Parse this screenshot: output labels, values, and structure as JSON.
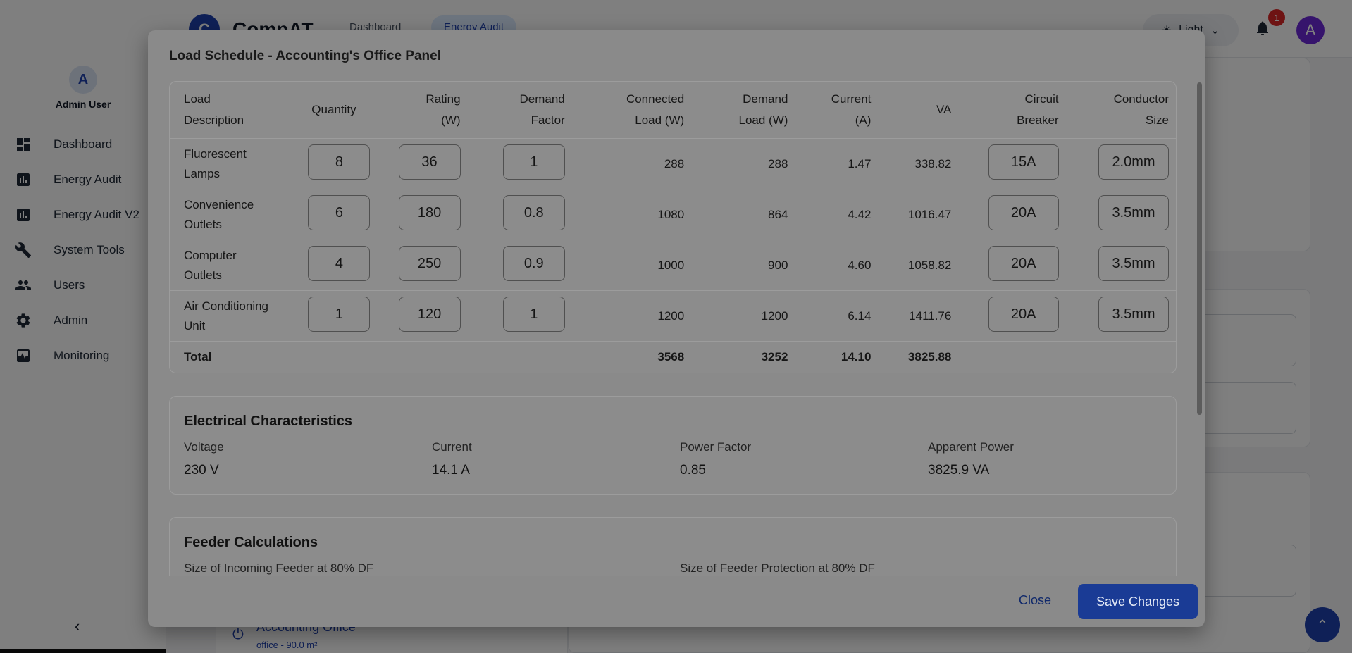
{
  "app": {
    "brand": "CompAT",
    "logo_letter": "C",
    "top_tabs": [
      "Dashboard",
      "Energy Audit"
    ],
    "theme_label": "Light",
    "notification_count": "1",
    "avatar_letter": "A"
  },
  "sidebar": {
    "avatar_letter": "A",
    "user_name": "Admin User",
    "items": [
      {
        "label": "Dashboard",
        "icon": "dashboard-icon"
      },
      {
        "label": "Energy Audit",
        "icon": "bar-chart-icon"
      },
      {
        "label": "Energy Audit V2",
        "icon": "bar-chart-icon"
      },
      {
        "label": "System Tools",
        "icon": "wrench-icon"
      },
      {
        "label": "Users",
        "icon": "users-icon"
      },
      {
        "label": "Admin",
        "icon": "gear-icon"
      },
      {
        "label": "Monitoring",
        "icon": "monitor-icon"
      }
    ],
    "collapse_glyph": "‹"
  },
  "background": {
    "office_name": "Accounting Office",
    "office_sub": "office - 90.0 m²"
  },
  "modal": {
    "title": "Load Schedule - Accounting's Office Panel",
    "headers": {
      "description": [
        "Load",
        "Description"
      ],
      "quantity": "Quantity",
      "rating": [
        "Rating",
        "(W)"
      ],
      "demand_factor": [
        "Demand",
        "Factor"
      ],
      "connected_load": [
        "Connected",
        "Load (W)"
      ],
      "demand_load": [
        "Demand",
        "Load (W)"
      ],
      "current": [
        "Current",
        "(A)"
      ],
      "va": "VA",
      "breaker": [
        "Circuit",
        "Breaker"
      ],
      "conductor": [
        "Conductor",
        "Size"
      ]
    },
    "rows": [
      {
        "desc1": "Fluorescent",
        "desc2": "Lamps",
        "quantity": "8",
        "rating": "36",
        "demand_factor": "1",
        "connected": "288",
        "demand": "288",
        "current": "1.47",
        "va": "338.82",
        "breaker": "15A",
        "conductor": "2.0mm"
      },
      {
        "desc1": "Convenience",
        "desc2": "Outlets",
        "quantity": "6",
        "rating": "180",
        "demand_factor": "0.8",
        "connected": "1080",
        "demand": "864",
        "current": "4.42",
        "va": "1016.47",
        "breaker": "20A",
        "conductor": "3.5mm"
      },
      {
        "desc1": "Computer",
        "desc2": "Outlets",
        "quantity": "4",
        "rating": "250",
        "demand_factor": "0.9",
        "connected": "1000",
        "demand": "900",
        "current": "4.60",
        "va": "1058.82",
        "breaker": "20A",
        "conductor": "3.5mm"
      },
      {
        "desc1": "Air Conditioning",
        "desc2": "Unit",
        "quantity": "1",
        "rating": "120",
        "demand_factor": "1",
        "connected": "1200",
        "demand": "1200",
        "current": "6.14",
        "va": "1411.76",
        "breaker": "20A",
        "conductor": "3.5mm"
      }
    ],
    "total": {
      "label": "Total",
      "connected": "3568",
      "demand": "3252",
      "current": "14.10",
      "va": "3825.88"
    },
    "electrical": {
      "title": "Electrical Characteristics",
      "voltage_label": "Voltage",
      "voltage_value": "230 V",
      "current_label": "Current",
      "current_value": "14.1 A",
      "pf_label": "Power Factor",
      "pf_value": "0.85",
      "apparent_label": "Apparent Power",
      "apparent_value": "3825.9 VA"
    },
    "feeder": {
      "title": "Feeder Calculations",
      "incoming_label": "Size of Incoming Feeder at 80% DF",
      "protection_label": "Size of Feeder Protection at 80% DF"
    },
    "close_label": "Close",
    "save_label": "Save Changes"
  }
}
